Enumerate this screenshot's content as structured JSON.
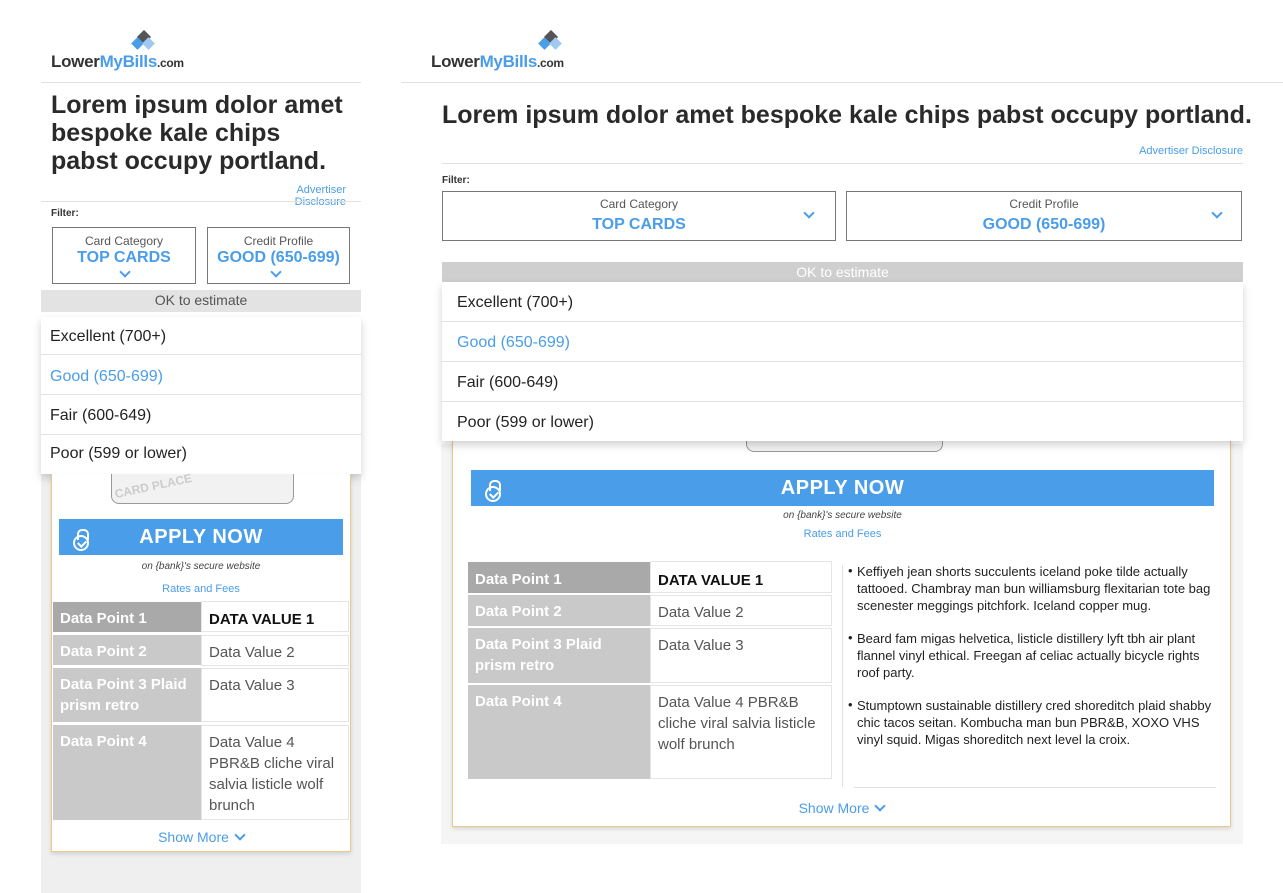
{
  "brand": {
    "logo_part1": "Lower",
    "logo_part2": "MyBills",
    "logo_part3": ".com"
  },
  "headline": "Lorem ipsum dolor amet bespoke kale chips pabst occupy portland.",
  "disclosure": "Advertiser Disclosure",
  "filter": {
    "label": "Filter:",
    "category": {
      "label": "Card Category",
      "value": "TOP CARDS"
    },
    "credit": {
      "label": "Credit Profile",
      "value": "GOOD (650-699)"
    },
    "estimate": "OK to estimate",
    "options": [
      "Excellent (700+)",
      "Good (650-699)",
      "Fair (600-649)",
      "Poor (599 or lower)"
    ],
    "selected_index": 1
  },
  "card_image_text": "CARD PLACE",
  "apply_label": "APPLY NOW",
  "secure_text": "on {bank}'s secure website",
  "rates_label": "Rates and Fees",
  "table": [
    {
      "key": "Data Point 1",
      "value": "DATA VALUE 1"
    },
    {
      "key": "Data Point 2",
      "value": "Data Value 2"
    },
    {
      "key": "Data Point 3 Plaid prism retro",
      "value": "Data Value 3"
    },
    {
      "key": "Data Point 4",
      "value": "Data Value 4 PBR&B cliche viral salvia listicle wolf brunch"
    }
  ],
  "bullets": [
    "Keffiyeh jean shorts succulents iceland poke tilde actually tattooed. Chambray man bun williamsburg flexitarian tote bag scenester meggings pitchfork. Iceland copper mug.",
    "Beard fam migas helvetica, listicle distillery lyft tbh air plant flannel vinyl ethical. Freegan af celiac actually bicycle rights roof party.",
    "Stumptown sustainable distillery cred  shoreditch plaid shabby chic tacos seitan. Kombucha man bun PBR&B, XOXO VHS vinyl squid. Migas shoreditch next level la croix."
  ],
  "show_more": "Show More",
  "colors": {
    "accent": "#4a9de8",
    "header_cell": "#a9a9a9",
    "cell": "#c9c9c9",
    "card_border": "#e8c98a"
  }
}
